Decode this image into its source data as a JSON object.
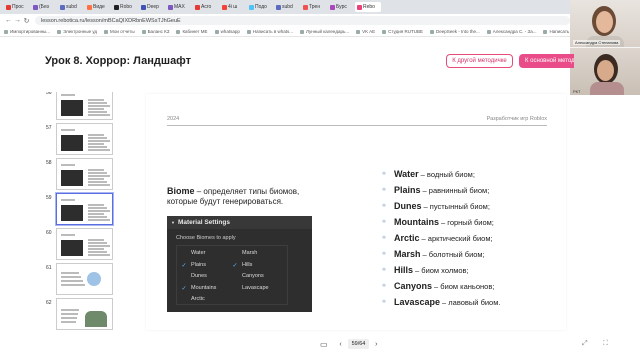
{
  "browser": {
    "tabs": [
      {
        "label": "Прос",
        "color": "#e53935"
      },
      {
        "label": "(Без",
        "color": "#7e57c2"
      },
      {
        "label": "subd",
        "color": "#5c6bc0"
      },
      {
        "label": "Виде",
        "color": "#ff7043"
      },
      {
        "label": "Robo",
        "color": "#222222"
      },
      {
        "label": "Deep",
        "color": "#3f51b5"
      },
      {
        "label": "MAX",
        "color": "#7e57c2"
      },
      {
        "label": "Acro",
        "color": "#e53935"
      },
      {
        "label": "4i ш",
        "color": "#f44336"
      },
      {
        "label": "Подо",
        "color": "#4fc3f7"
      },
      {
        "label": "subd",
        "color": "#5c6bc0"
      },
      {
        "label": "Трен",
        "color": "#ef5350"
      },
      {
        "label": "Бурс",
        "color": "#ab47bc"
      },
      {
        "label": "Rebo",
        "color": "#ec407a"
      }
    ],
    "url": "lesson.rebotica.ru/lesson/mBCaQIXDRbnEWSsTJhGeuE",
    "bookmarks": [
      "Импортированны...",
      "Электронные уд",
      "Мои отчеты",
      "Баланс КЗ",
      "Кабинет МЕ",
      "whatsapp",
      "Написать в whats...",
      "Лунный календарь...",
      "VK AE",
      "Студия RUTUBE",
      "DeepSeek - Into the...",
      "Александра С. - За...",
      "Написать в Telegra..."
    ]
  },
  "call": {
    "participant1": "Александра Степанова",
    "participant2": "РКТ"
  },
  "header": {
    "lesson_title": "Урок 8. Хоррор: Ландшафт",
    "other_button": "К другой методичке",
    "main_button": "К основной метод"
  },
  "thumbnails": [
    {
      "num": "56",
      "style": "dark"
    },
    {
      "num": "57",
      "style": "dark"
    },
    {
      "num": "58",
      "style": "dark"
    },
    {
      "num": "59",
      "style": "dark",
      "selected": true
    },
    {
      "num": "60",
      "style": "dark"
    },
    {
      "num": "61",
      "style": "pink"
    },
    {
      "num": "62",
      "style": "arch"
    }
  ],
  "slide": {
    "year": "2024",
    "developer": "Разработчик игр Roblox",
    "biome_term": "Biome",
    "biome_desc": " – определяет типы биомов, которые будут генерироваться.",
    "material_settings": {
      "title": "Material Settings",
      "subtitle": "Choose Biomes to apply",
      "options": [
        {
          "label": "Water",
          "checked": false
        },
        {
          "label": "Marsh",
          "checked": false
        },
        {
          "label": "Plains",
          "checked": true
        },
        {
          "label": "Hills",
          "checked": true
        },
        {
          "label": "Dunes",
          "checked": false
        },
        {
          "label": "Canyons",
          "checked": false
        },
        {
          "label": "Mountains",
          "checked": true
        },
        {
          "label": "Lavascape",
          "checked": false
        },
        {
          "label": "Arctic",
          "checked": false
        }
      ]
    },
    "biome_list": [
      {
        "name": "Water",
        "desc": "– водный биом;"
      },
      {
        "name": "Plains",
        "desc": "– равнинный биом;"
      },
      {
        "name": "Dunes",
        "desc": "– пустынный биом;"
      },
      {
        "name": "Mountains",
        "desc": "– горный биом;"
      },
      {
        "name": "Arctic",
        "desc": "– арктический биом;"
      },
      {
        "name": "Marsh",
        "desc": "– болотный биом;"
      },
      {
        "name": "Hills",
        "desc": "– биом холмов;"
      },
      {
        "name": "Canyons",
        "desc": "– биом каньонов;"
      },
      {
        "name": "Lavascape",
        "desc": "– лавовый биом."
      }
    ]
  },
  "pager": {
    "current": "59",
    "total": "64",
    "separator": "/"
  },
  "colors": {
    "accent": "#ea4c89",
    "selected_thumb": "#5b6ee1"
  }
}
